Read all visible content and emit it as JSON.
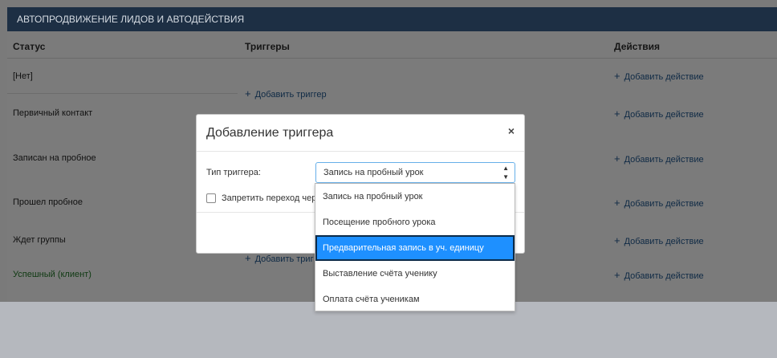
{
  "section": {
    "title": "АВТОПРОДВИЖЕНИЕ ЛИДОВ И АВТОДЕЙСТВИЯ"
  },
  "table": {
    "headers": {
      "status": "Статус",
      "triggers": "Триггеры",
      "actions": "Действия"
    },
    "rows": [
      {
        "status": "[Нет]"
      },
      {
        "status": "Первичный контакт"
      },
      {
        "status": "Записан на пробное"
      },
      {
        "status": "Прошел пробное"
      },
      {
        "status": "Ждет группы"
      },
      {
        "status": "Успешный (клиент)"
      }
    ],
    "add_trigger_label": "Добавить триггер",
    "add_trigger_label_partial": "Добавить триг",
    "add_action_label": "Добавить действие",
    "plus": "+"
  },
  "modal": {
    "title": "Добавление триггера",
    "close": "×",
    "field_label": "Тип триггера:",
    "select_value": "Запись на пробный урок",
    "checkbox_label": "Запретить переход чер",
    "options": [
      "Запись на пробный урок",
      "Посещение пробного урока",
      "Предварительная запись в уч. единицу",
      "Выставление счёта ученику",
      "Оплата счёта ученикам"
    ],
    "selected_option_index": 2
  },
  "colors": {
    "header_bg": "#1d2f44",
    "selected_option": "#1e90ff",
    "overlay": "#7a7a7a"
  }
}
